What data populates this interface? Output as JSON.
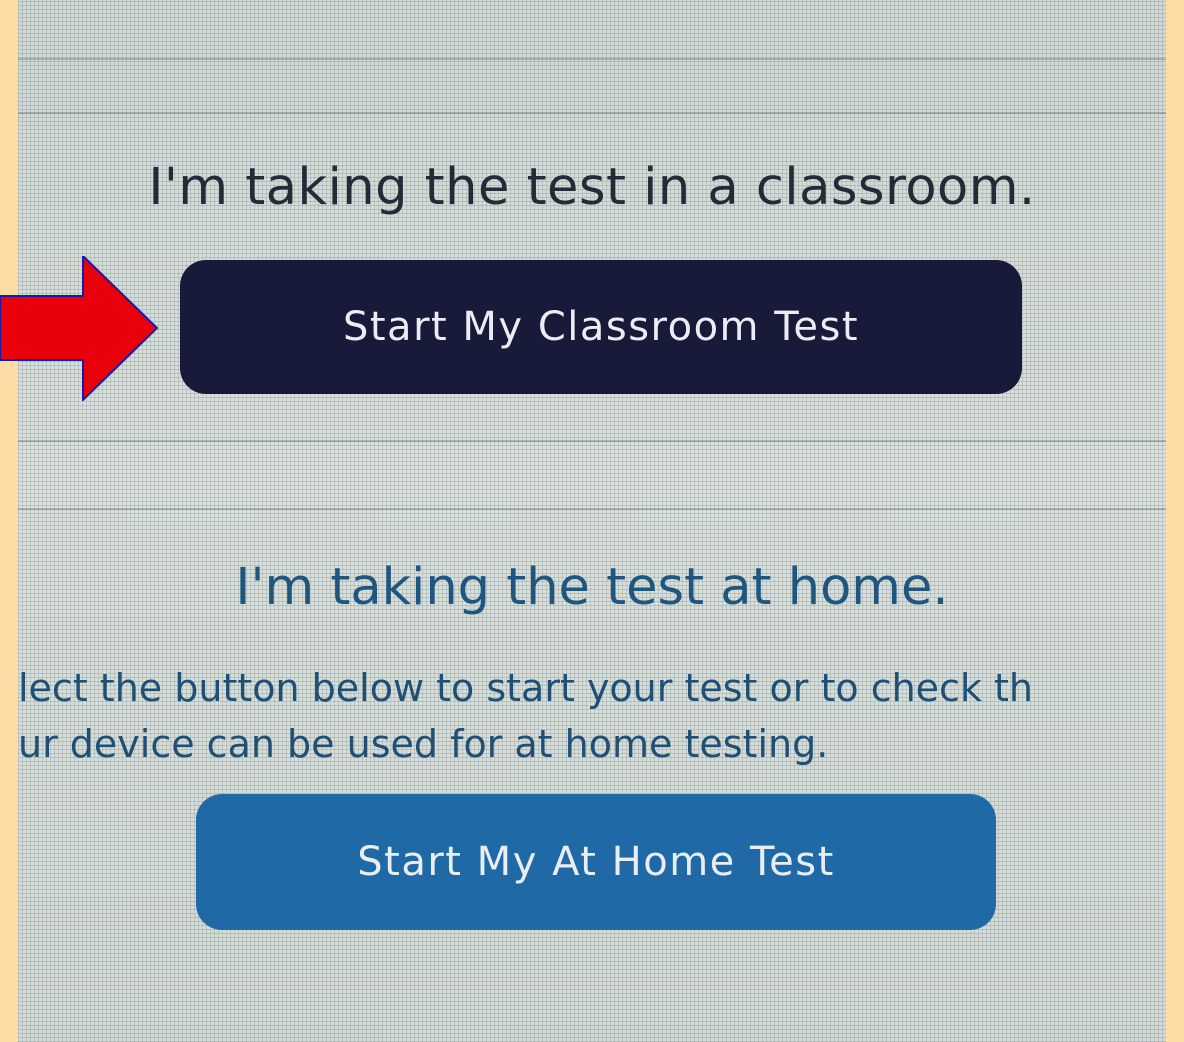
{
  "classroom": {
    "heading": "I'm taking the test in a classroom.",
    "button_label": "Start My Classroom Test"
  },
  "home": {
    "heading": "I'm taking the test at home.",
    "instruction_line1": "lect the button below to start your test or to check th",
    "instruction_line2": "ur device can be used for at home testing.",
    "button_label": "Start My At Home Test"
  },
  "annotation": {
    "arrow_icon": "right-arrow-icon",
    "arrow_color": "#e8000b"
  },
  "colors": {
    "page_border": "#fddca6",
    "classroom_button": "#171a38",
    "home_button": "#1f6aa6",
    "home_heading": "#1f5680"
  }
}
